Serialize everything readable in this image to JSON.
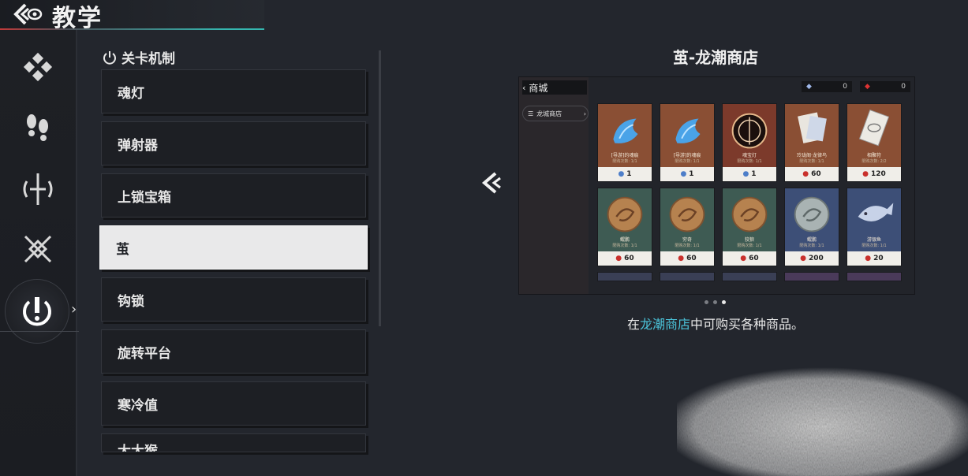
{
  "header": {
    "title": "教学"
  },
  "section": {
    "title": "关卡机制"
  },
  "list": {
    "items": [
      "魂灯",
      "弹射器",
      "上锁宝箱",
      "茧",
      "钩锁",
      "旋转平台",
      "寒冷值",
      "大大猴"
    ],
    "selected_index": 3
  },
  "rail": {
    "icons": [
      "diamond-grid-icon",
      "footprints-icon",
      "sword-icon",
      "crossed-blades-icon",
      "mechanism-icon"
    ],
    "active_index": 4
  },
  "detail": {
    "title": "茧-龙潮商店",
    "caption_pre": "在",
    "caption_highlight": "龙潮商店",
    "caption_post": "中可购买各种商品。",
    "page_index": 2,
    "page_count": 3
  },
  "preview": {
    "shop_title": "商城",
    "shop_tab": "龙城商店",
    "currency_a": "0",
    "currency_b": "0",
    "cards": [
      {
        "name": "[导游]的魂痕",
        "limit": "限购次数: 1/1",
        "price": "1",
        "currency": "blue",
        "bg": "#8a4f34",
        "art": "flame"
      },
      {
        "name": "[导游]的魂痕",
        "limit": "限购次数: 1/1",
        "price": "1",
        "currency": "blue",
        "bg": "#8a4f34",
        "art": "flame"
      },
      {
        "name": "魂宝灯",
        "limit": "限购次数: 1/1",
        "price": "1",
        "currency": "blue",
        "bg": "#7c3a2b",
        "art": "orb"
      },
      {
        "name": "玲珑阁·龙律鸟",
        "limit": "限购次数: 1/1",
        "price": "60",
        "currency": "red",
        "bg": "#8a4f34",
        "art": "paper"
      },
      {
        "name": "相聚符",
        "limit": "限购次数: 2/2",
        "price": "120",
        "currency": "red",
        "bg": "#8a4f34",
        "art": "talisman"
      },
      {
        "name": "鲲鹏",
        "limit": "限购次数: 1/1",
        "price": "60",
        "currency": "red",
        "bg": "#3e5b53",
        "art": "coin"
      },
      {
        "name": "穷奇",
        "limit": "限购次数: 1/1",
        "price": "60",
        "currency": "red",
        "bg": "#3e5b53",
        "art": "coin"
      },
      {
        "name": "狡狼",
        "limit": "限购次数: 1/1",
        "price": "60",
        "currency": "red",
        "bg": "#3e5b53",
        "art": "coin"
      },
      {
        "name": "鲲鹏",
        "limit": "限购次数: 1/1",
        "price": "200",
        "currency": "red",
        "bg": "#3d4f77",
        "art": "silver"
      },
      {
        "name": "游银鱼",
        "limit": "限购次数: 1/1",
        "price": "20",
        "currency": "red",
        "bg": "#3d4f77",
        "art": "fish"
      }
    ]
  },
  "colors": {
    "accent_cyan": "#4bc3d9",
    "accent_red": "#c23a3a",
    "selected_bg": "#e9e9ea"
  }
}
